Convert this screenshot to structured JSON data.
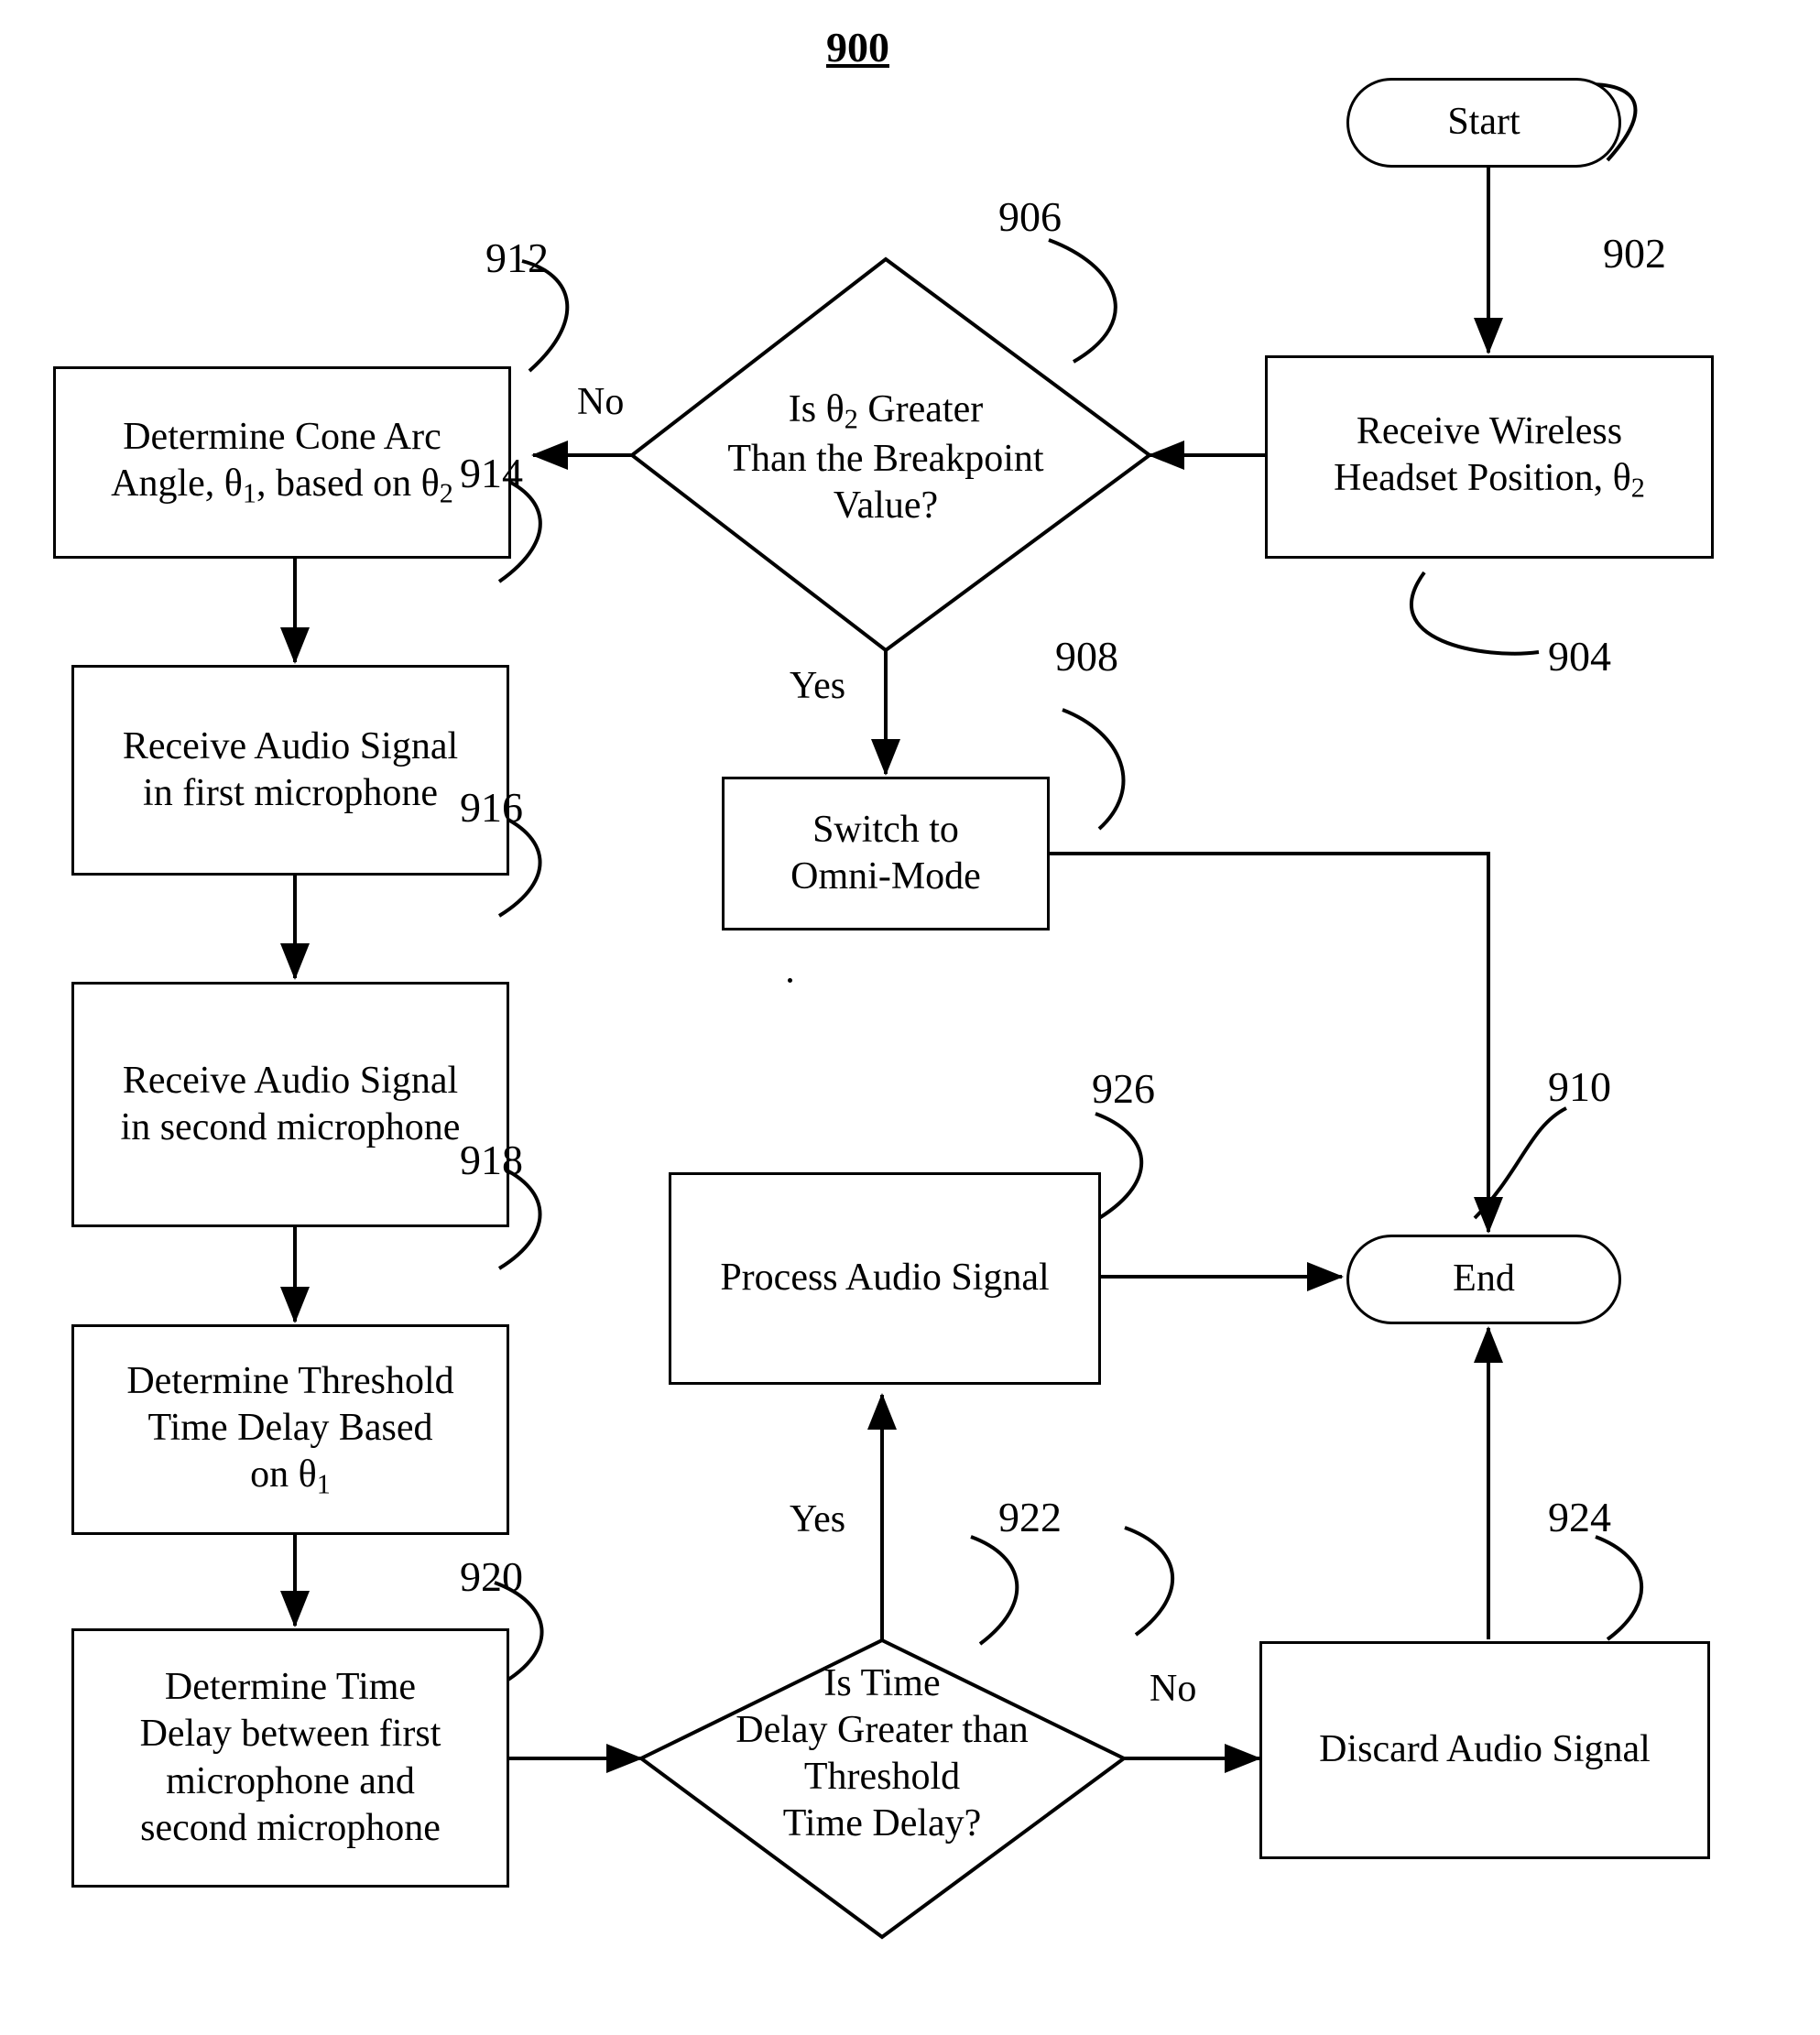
{
  "diagram": {
    "figure_number": "900",
    "type": "flowchart",
    "title": "Flowchart 900"
  },
  "nodes": {
    "start": {
      "label": "Start",
      "ref": "902",
      "shape": "terminator"
    },
    "receive_position": {
      "line1": "Receive Wireless",
      "line2": "Headset Position, θ",
      "sub2": "2",
      "ref": "904",
      "shape": "process"
    },
    "breakpoint_decision": {
      "line1": "Is θ",
      "sub1": "2",
      "line1b": " Greater",
      "line2": "Than the Breakpoint",
      "line3": "Value?",
      "ref": "906",
      "shape": "decision"
    },
    "switch_omni": {
      "line1": "Switch to",
      "line2": "Omni-Mode",
      "ref": "908",
      "shape": "process"
    },
    "end": {
      "label": "End",
      "ref": "910",
      "shape": "terminator"
    },
    "cone_arc": {
      "line1": "Determine Cone Arc",
      "line2pre": "Angle, θ",
      "sub2": "1",
      "line2post": ", based on θ",
      "sub3": "2",
      "ref": "912",
      "shape": "process"
    },
    "audio_first_mic": {
      "line1": "Receive Audio Signal",
      "line2": "in first microphone",
      "ref": "914",
      "shape": "process"
    },
    "audio_second_mic": {
      "line1": "Receive Audio Signal",
      "line2": "in second microphone",
      "ref": "916",
      "shape": "process"
    },
    "threshold_delay": {
      "line1": "Determine Threshold",
      "line2": "Time Delay Based",
      "line3pre": "on θ",
      "sub3": "1",
      "ref": "918",
      "shape": "process"
    },
    "time_delay": {
      "line1": "Determine Time",
      "line2": "Delay between first",
      "line3": "microphone and",
      "line4": "second microphone",
      "ref": "920",
      "shape": "process"
    },
    "delay_decision": {
      "line1": "Is Time",
      "line2": "Delay Greater than",
      "line3": "Threshold",
      "line4": "Time Delay?",
      "ref": "922",
      "shape": "decision"
    },
    "discard_audio": {
      "label": "Discard Audio Signal",
      "ref": "924",
      "shape": "process"
    },
    "process_audio": {
      "label": "Process Audio Signal",
      "ref": "926",
      "shape": "process"
    }
  },
  "edge_labels": {
    "breakpoint_no": "No",
    "breakpoint_yes": "Yes",
    "delay_yes": "Yes",
    "delay_no": "No"
  }
}
